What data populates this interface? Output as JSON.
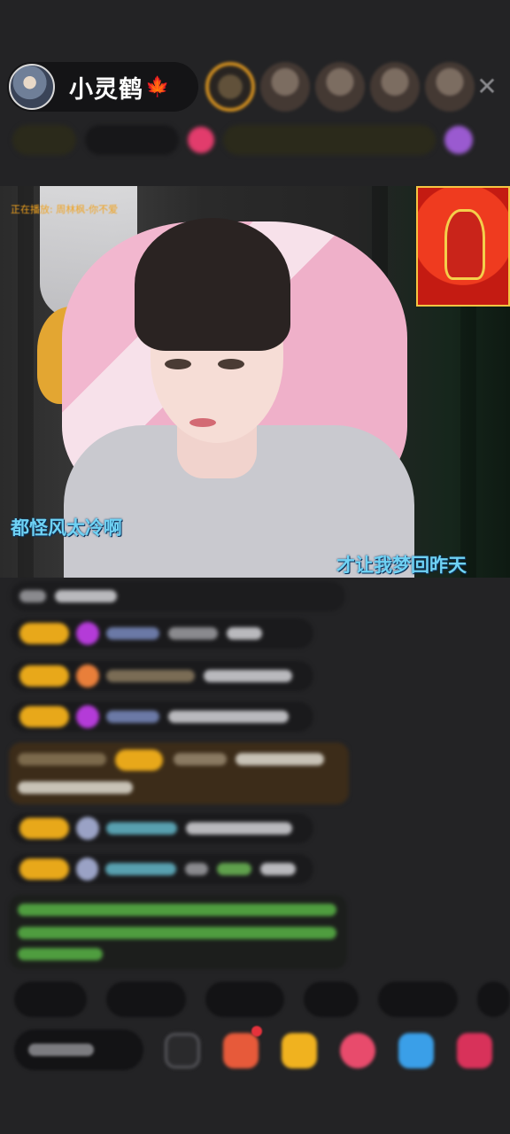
{
  "header": {
    "host_name": "小灵鹤",
    "host_emoji": "🍁",
    "close_glyph": "✕",
    "viewer_count": 5
  },
  "video": {
    "now_playing": "正在播放: 周林枫-你不爱",
    "lyric_left": "都怪风太冷啊",
    "lyric_right": "才让我梦回昨天"
  },
  "chat": {
    "messages": 8
  },
  "colors": {
    "level_badge": "#e8a81a",
    "lyric": "#6fd2f4",
    "accent_gold": "#f0a21f",
    "background": "#232325"
  }
}
